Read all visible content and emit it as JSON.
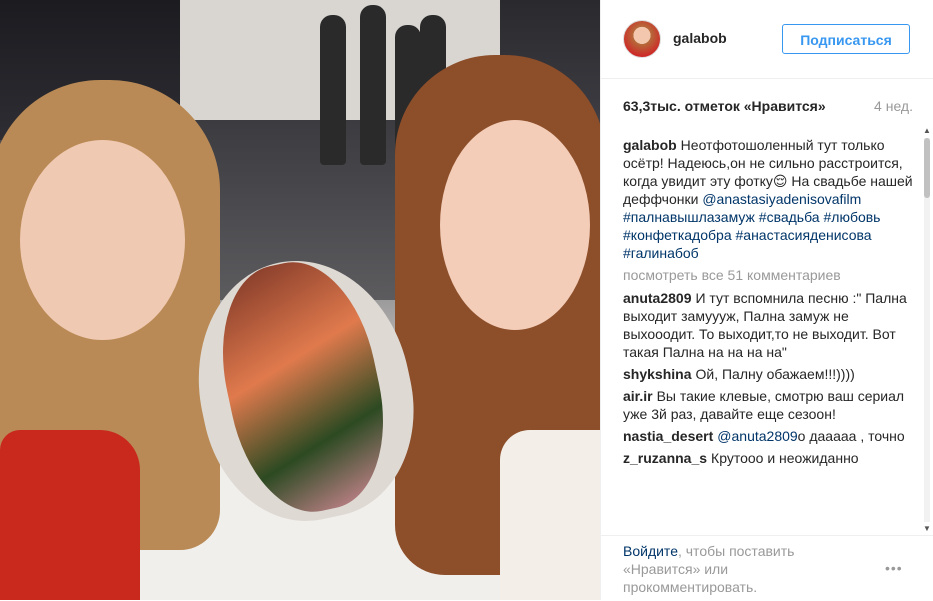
{
  "post": {
    "username": "galabob",
    "follow_label": "Подписаться",
    "likes": "63,3тыс. отметок «Нравится»",
    "time_ago": "4 нед."
  },
  "comments": [
    {
      "user": "galabob",
      "text": "Неотфотошоленный тут только осётр! Надеюсь,он не сильно расстроится, когда увидит эту фотку😌 На свадьбе нашей деффчонки ",
      "links": [
        "@anastasiyadenisovafilm",
        "#палнавышлазамуж",
        "#свадьба",
        "#любовь",
        "#конфеткадобра",
        "#анастасияденисова",
        "#галинабоб"
      ]
    },
    {
      "user": "anuta2809",
      "text": "И тут вспомнила песню :\" Пална выходит замуууж, Пална замуж не выхооодит. То выходит,то не выходит. Вот такая Пална на на на на\""
    },
    {
      "user": "shykshina",
      "text": "Ой, Палну обажаем!!!))))"
    },
    {
      "user": "air.ir",
      "text": "Вы такие клевые, смотрю ваш сериал уже 3й раз, давайте еще сезоон!"
    },
    {
      "user": "nastia_desert",
      "mention": "@anuta2809",
      "text": "о дааааа , точно"
    },
    {
      "user": "z_ruzanna_s",
      "text": "Крутооо и неожиданно"
    }
  ],
  "view_all_label": "посмотреть все 51 комментариев",
  "footer": {
    "login_link": "Войдите",
    "login_text": ", чтобы поставить «Нравится» или прокомментировать.",
    "more_icon": "•••"
  },
  "icons": {
    "scroll_up": "▲",
    "scroll_down": "▼"
  },
  "colors": {
    "accent": "#3897f0",
    "link": "#003569",
    "muted": "#999999"
  }
}
